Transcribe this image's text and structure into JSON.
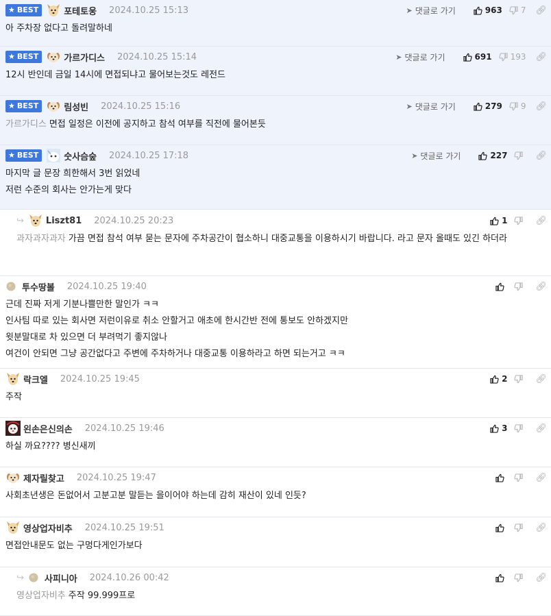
{
  "ui": {
    "best_label": "BEST",
    "goto_label": "댓글로 가기"
  },
  "comments": [
    {
      "id": "c1",
      "best": true,
      "nick": "포테토웅",
      "date": "2024.10.25 15:13",
      "up": "963",
      "down": "7",
      "mention": "",
      "lines": [
        "아 주차장 없다고 돌려말하네"
      ],
      "avatar": "dog"
    },
    {
      "id": "c2",
      "best": true,
      "nick": "가르가디스",
      "date": "2024.10.25 15:14",
      "up": "691",
      "down": "193",
      "mention": "",
      "lines": [
        "12시 반인데 금일 14시에 면접되냐고 물어보는것도 레전드"
      ],
      "avatar": "puppy"
    },
    {
      "id": "c3",
      "best": true,
      "nick": "림성빈",
      "date": "2024.10.25 15:16",
      "up": "279",
      "down": "9",
      "mention": "가르가디스",
      "lines": [
        "면접 일정은 이전에 공지하고 참석 여부를 직전에 물어본듯"
      ],
      "avatar": "puppy"
    },
    {
      "id": "c4",
      "best": true,
      "nick": "숫사슴숲",
      "date": "2024.10.25 17:18",
      "up": "227",
      "down": "",
      "mention": "",
      "lines": [
        "마지막 글 문장 희한해서 3번 읽었네",
        "저런 수준의 회사는 안가는게 맞다"
      ],
      "avatar": "cat"
    },
    {
      "id": "c5",
      "best": false,
      "reply": true,
      "nick": "Liszt81",
      "date": "2024.10.25 20:23",
      "up": "1",
      "down": "",
      "mention": "과자과자과자",
      "lines": [
        "가끔 면접 참석 여부 묻는 문자에 주차공간이 협소하니 대중교통을 이용하시기 바랍니다. 라고 문자 올때도 있긴 하더라"
      ],
      "avatar": "dog"
    },
    {
      "id": "c6",
      "best": false,
      "nick": "투수땅볼",
      "date": "2024.10.25 19:40",
      "up": "",
      "down": "",
      "mention": "",
      "lines": [
        "근데 진짜 저게 기분나쁠만한 말인가 ㅋㅋ",
        "인사팀 따로 있는 회사면 저런이유로 취소 안할거고 애초에 한시간반 전에 통보도 안하겠지만",
        "윗분말대로 차 있으면 더 부려먹기 좋지않나",
        "여건이 안되면 그냥 공간없다고 주변에 주차하거나 대중교통 이용하라고 하면 되는거고 ㅋㅋ"
      ],
      "avatar": "ball"
    },
    {
      "id": "c7",
      "best": false,
      "nick": "락크엘",
      "date": "2024.10.25 19:45",
      "up": "2",
      "down": "",
      "mention": "",
      "lines": [
        "주작"
      ],
      "avatar": "dog"
    },
    {
      "id": "c8",
      "best": false,
      "nick": "왼손은신의손",
      "date": "2024.10.25 19:46",
      "up": "3",
      "down": "",
      "mention": "",
      "lines": [
        "하실 까요???? 병신새끼"
      ],
      "avatar": "girl"
    },
    {
      "id": "c9",
      "best": false,
      "nick": "제자릴찾고",
      "date": "2024.10.25 19:47",
      "up": "",
      "down": "",
      "mention": "",
      "lines": [
        "사회초년생은 돈없어서 고분고분 말듣는 을이어야 하는데 감히 재산이 있네 인듯?"
      ],
      "avatar": "puppy"
    },
    {
      "id": "c10",
      "best": false,
      "nick": "영상업자비추",
      "date": "2024.10.25 19:51",
      "up": "",
      "down": "",
      "mention": "",
      "lines": [
        "면접안내문도 없는 구멍다게인가보다"
      ],
      "avatar": "dog"
    },
    {
      "id": "c11",
      "best": false,
      "reply": true,
      "nick": "사피니아",
      "date": "2024.10.26 00:42",
      "up": "",
      "down": "",
      "mention": "영상업자비추",
      "lines": [
        "주작 99.999프로"
      ],
      "avatar": "ball"
    }
  ]
}
